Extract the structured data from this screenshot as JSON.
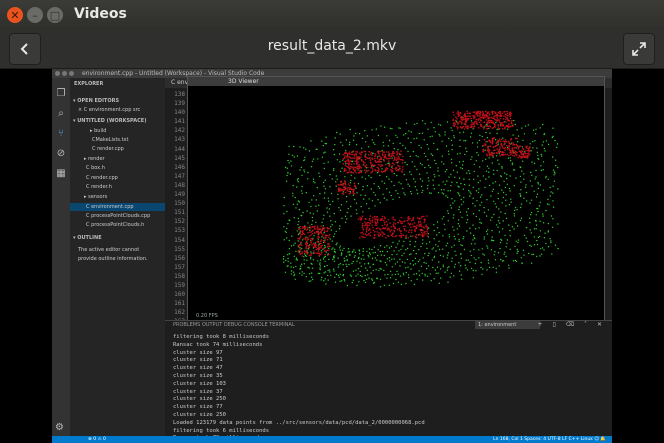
{
  "window": {
    "app_title": "Videos",
    "file_name": "result_data_2.mkv"
  },
  "vscode": {
    "title": "environment.cpp - Untitled (Workspace) - Visual Studio Code",
    "sidebar_lines": [
      {
        "text": "EXPLORER",
        "style": "head",
        "indent": 4
      },
      {
        "text": "▾ OPEN EDITORS",
        "style": "head",
        "indent": 3
      },
      {
        "text": "× C environment.cpp src",
        "style": "",
        "indent": 8
      },
      {
        "text": "▾ UNTITLED (WORKSPACE)",
        "style": "head",
        "indent": 3
      },
      {
        "text": "▸ build",
        "style": "",
        "indent": 20
      },
      {
        "text": "CMakeLists.txt",
        "style": "",
        "indent": 22
      },
      {
        "text": "C render.cpp",
        "style": "",
        "indent": 22
      },
      {
        "text": "▸ render",
        "style": "",
        "indent": 14
      },
      {
        "text": "C box.h",
        "style": "",
        "indent": 16
      },
      {
        "text": "C render.cpp",
        "style": "",
        "indent": 16
      },
      {
        "text": "C render.h",
        "style": "",
        "indent": 16
      },
      {
        "text": "▸ sensors",
        "style": "",
        "indent": 14
      },
      {
        "text": "C environment.cpp",
        "style": "hl",
        "indent": 16
      },
      {
        "text": "C processPointClouds.cpp",
        "style": "",
        "indent": 16
      },
      {
        "text": "C processPointClouds.h",
        "style": "",
        "indent": 16
      },
      {
        "text": "▾ OUTLINE",
        "style": "head",
        "indent": 3
      },
      {
        "text": "The active editor cannot",
        "style": "",
        "indent": 8
      },
      {
        "text": "provide outline information.",
        "style": "",
        "indent": 8
      }
    ],
    "tab_label": "C environment.cpp ×",
    "line_numbers": [
      "138",
      "139",
      "140",
      "141",
      "142",
      "143",
      "144",
      "145",
      "146",
      "147",
      "148",
      "149",
      "150",
      "151",
      "152",
      "153",
      "154",
      "155",
      "156",
      "157",
      "158",
      "159",
      "160",
      "161",
      "162",
      "163"
    ],
    "viewer_title": "3D Viewer",
    "fps_label": "0.20 FPS",
    "panel_tabs": "PROBLEMS    OUTPUT    DEBUG CONSOLE    TERMINAL",
    "terminal_select": "1: environment",
    "terminal_lines": [
      "filtering took 8 milliseconds",
      "Ransac took 74 milliseconds",
      "cluster size 97",
      "cluster size 71",
      "cluster size 47",
      "cluster size 35",
      "cluster size 103",
      "cluster size 37",
      "cluster size 250",
      "cluster size 77",
      "cluster size 250",
      "Loaded 123179 data points from ../src/sensors/data/pcd/data_2/0000000068.pcd",
      "filtering took 6 milliseconds",
      "Ransac took 79 milliseconds",
      "▏"
    ],
    "status_left": "⊗ 0 ⚠ 0",
    "status_right": "Ln 168, Col 1  Spaces: 4  UTF-8  LF  C++  Linux  ☺  🔔"
  },
  "colors": {
    "points_green": "#2fcf2f",
    "obstacle_red": "#c0101a",
    "accent_blue": "#007acc"
  }
}
